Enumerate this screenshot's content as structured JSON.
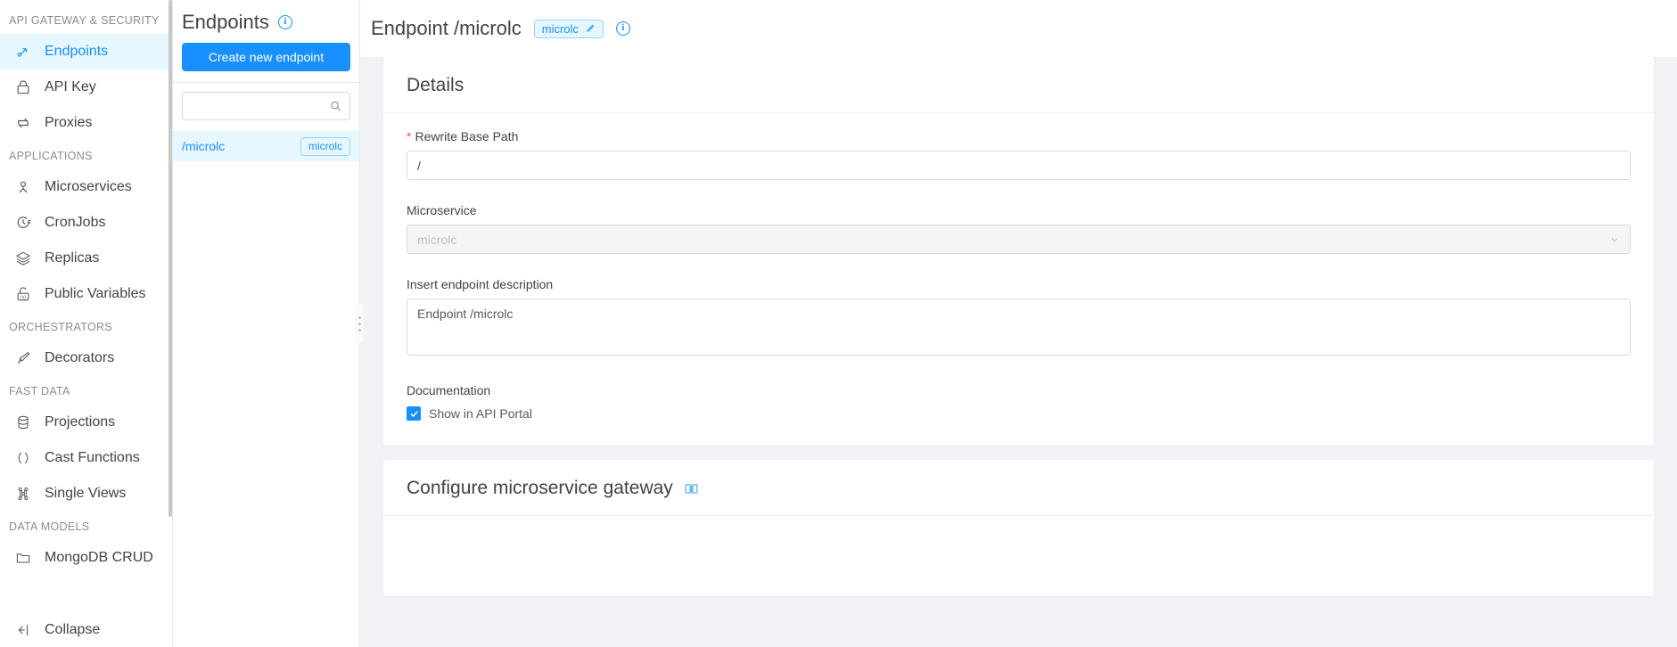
{
  "sidebar": {
    "groups": [
      {
        "title": "API GATEWAY & SECURITY",
        "items": [
          {
            "label": "Endpoints",
            "icon": "endpoint-icon",
            "active": true
          },
          {
            "label": "API Key",
            "icon": "lock-icon",
            "active": false
          },
          {
            "label": "Proxies",
            "icon": "swap-icon",
            "active": false
          }
        ]
      },
      {
        "title": "APPLICATIONS",
        "items": [
          {
            "label": "Microservices",
            "icon": "microservice-icon",
            "active": false
          },
          {
            "label": "CronJobs",
            "icon": "clock-icon",
            "active": false
          },
          {
            "label": "Replicas",
            "icon": "layers-icon",
            "active": false
          },
          {
            "label": "Public Variables",
            "icon": "unlock-variable-icon",
            "active": false
          }
        ]
      },
      {
        "title": "ORCHESTRATORS",
        "items": [
          {
            "label": "Decorators",
            "icon": "pen-icon",
            "active": false
          }
        ]
      },
      {
        "title": "FAST DATA",
        "items": [
          {
            "label": "Projections",
            "icon": "database-icon",
            "active": false
          },
          {
            "label": "Cast Functions",
            "icon": "parentheses-icon",
            "active": false
          },
          {
            "label": "Single Views",
            "icon": "graph-nodes-icon",
            "active": false
          }
        ]
      },
      {
        "title": "DATA MODELS",
        "items": [
          {
            "label": "MongoDB CRUD",
            "icon": "folder-icon",
            "active": false
          }
        ]
      }
    ],
    "collapse_label": "Collapse",
    "collapse_icon": "collapse-left-icon"
  },
  "list_panel": {
    "title": "Endpoints",
    "info_icon": "info-circle-icon",
    "create_button": "Create new endpoint",
    "search": {
      "value": "",
      "placeholder": "",
      "icon": "search-icon"
    },
    "endpoints": [
      {
        "path": "/microlc",
        "tag": "microlc",
        "selected": true
      }
    ]
  },
  "main": {
    "header": {
      "title": "Endpoint /microlc",
      "tag": "microlc",
      "tag_edit_icon": "pencil-icon",
      "info_icon": "info-circle-icon"
    },
    "details_card": {
      "title": "Details",
      "rewrite_base_path": {
        "label": "Rewrite Base Path",
        "required": true,
        "value": "/",
        "placeholder": ""
      },
      "microservice": {
        "label": "Microservice",
        "value": "microlc",
        "disabled": true,
        "chevron_icon": "chevron-down-icon"
      },
      "description": {
        "label": "Insert endpoint description",
        "value": "Endpoint /microlc",
        "placeholder": ""
      },
      "documentation": {
        "label": "Documentation",
        "checkbox_label": "Show in API Portal",
        "checked": true
      }
    },
    "gateway_card": {
      "title": "Configure microservice gateway",
      "doc_icon": "book-icon"
    }
  },
  "colors": {
    "accent": "#1890ff",
    "accent_bg": "#e6f7ff",
    "accent_border": "#91d5ff",
    "required": "#ff4d4f",
    "page_bg": "#f0f2f5",
    "text": "#434343",
    "muted": "#8c8c8c"
  }
}
